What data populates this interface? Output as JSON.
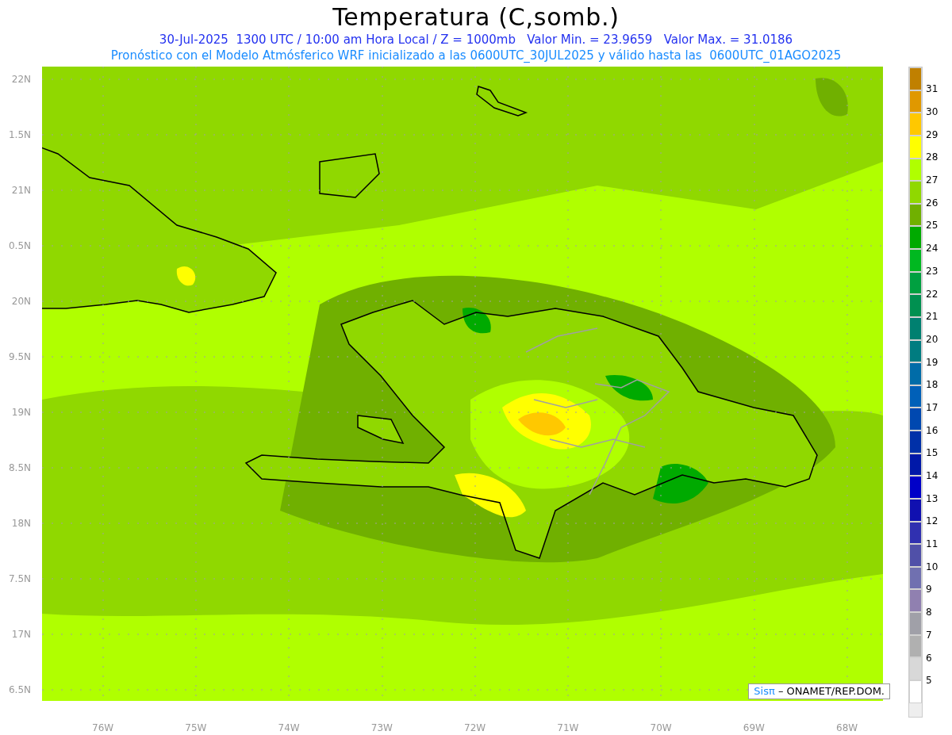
{
  "title": "Temperatura (C,somb.)",
  "subtitles": [
    {
      "text": "30-Jul-2025  1300 UTC / 10:00 am Hora Local / Z = 1000mb   Valor Min. = 23.9659   Valor Max. = 31.0186",
      "color": "#2432f0"
    },
    {
      "text": "Pronóstico con el Modelo Atmósferico WRF inicializado a las 0600UTC_30JUL2025 y válido hasta las  0600UTC_01AGO2025",
      "color": "#1a8cff"
    }
  ],
  "map": {
    "lat_labels": [
      "22N",
      "1.5N",
      "21N",
      "0.5N",
      "20N",
      "9.5N",
      "19N",
      "8.5N",
      "18N",
      "7.5N",
      "17N",
      "6.5N"
    ],
    "lon_labels": [
      "76W",
      "75W",
      "74W",
      "73W",
      "72W",
      "71W",
      "70W",
      "69W",
      "68W"
    ],
    "credit": {
      "logo": "Sisπ",
      "text": "– ONAMET/REP.DOM."
    }
  },
  "legend": {
    "bins": [
      {
        "color": "#c08000"
      },
      {
        "color": "#e09800"
      },
      {
        "color": "#ffc800"
      },
      {
        "color": "#ffff00"
      },
      {
        "color": "#b0ff00"
      },
      {
        "color": "#90d800"
      },
      {
        "color": "#70b000"
      },
      {
        "color": "#00aa00"
      },
      {
        "color": "#00b820"
      },
      {
        "color": "#00a040"
      },
      {
        "color": "#009050"
      },
      {
        "color": "#008070"
      },
      {
        "color": "#007c80"
      },
      {
        "color": "#006ca8"
      },
      {
        "color": "#0060b8"
      },
      {
        "color": "#0048b0"
      },
      {
        "color": "#0030a8"
      },
      {
        "color": "#0018a8"
      },
      {
        "color": "#0000c8"
      },
      {
        "color": "#1010b0"
      },
      {
        "color": "#3030b0"
      },
      {
        "color": "#5050a8"
      },
      {
        "color": "#7070b0"
      },
      {
        "color": "#9080b0"
      },
      {
        "color": "#a0a0a8"
      },
      {
        "color": "#b0b0b0"
      },
      {
        "color": "#d8d8d8"
      },
      {
        "color": "#ffffff"
      }
    ],
    "labels": [
      "31",
      "30",
      "29",
      "28",
      "27",
      "26",
      "25",
      "24",
      "23",
      "22",
      "21",
      "20",
      "19",
      "18",
      "17",
      "16",
      "15",
      "14",
      "13",
      "12",
      "11",
      "10",
      "9",
      "8",
      "7",
      "6",
      "5"
    ]
  }
}
